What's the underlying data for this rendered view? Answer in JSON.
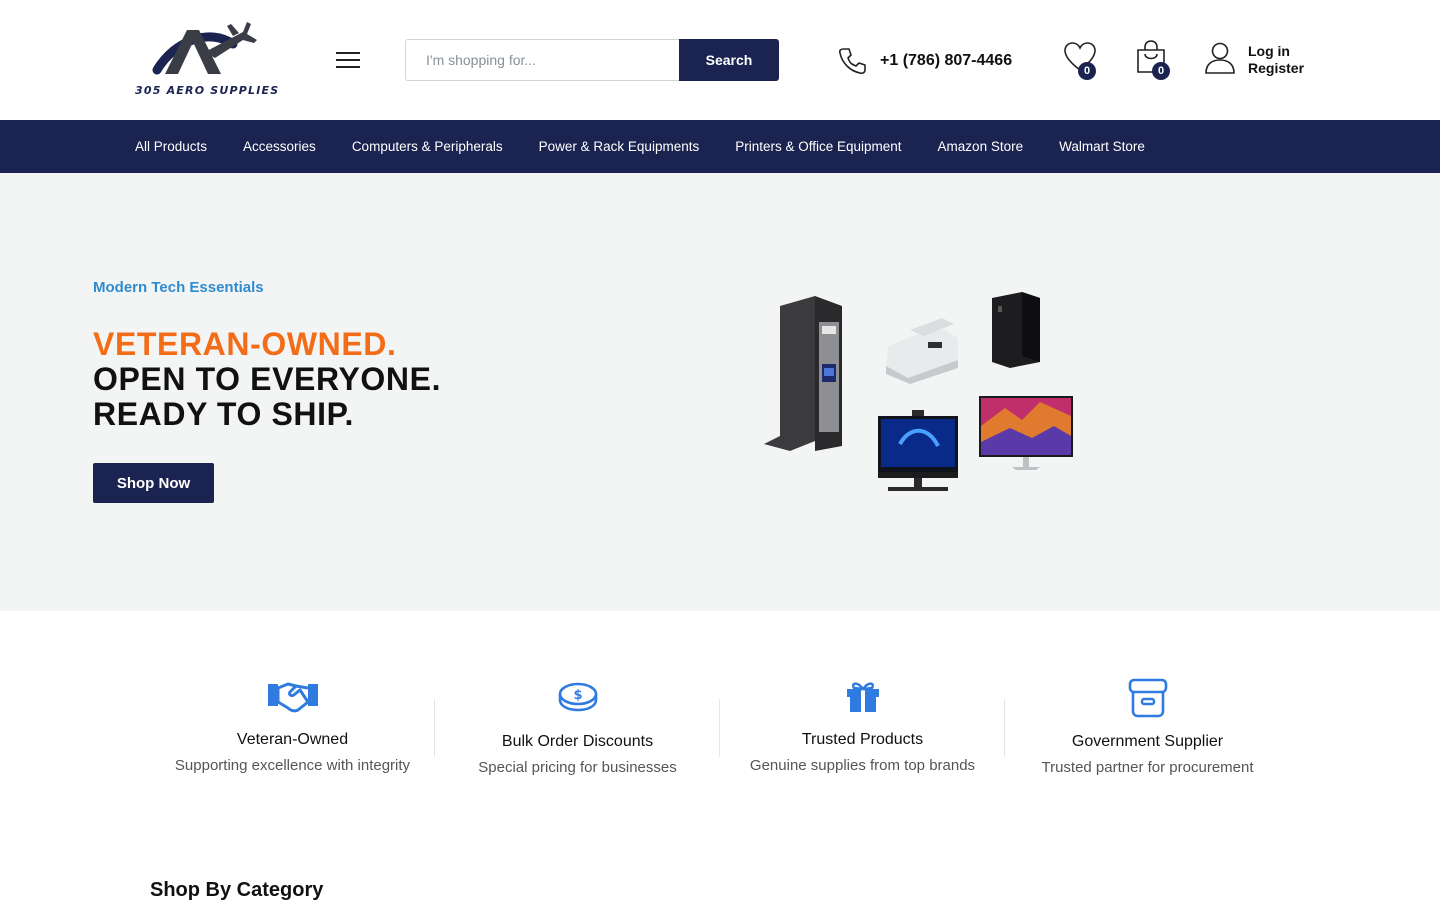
{
  "header": {
    "logo_text": "305  AERO  SUPPLIES",
    "search_placeholder": "I'm shopping for...",
    "search_button": "Search",
    "phone": "+1 (786) 807-4466",
    "wishlist_count": "0",
    "cart_count": "0",
    "login": "Log in",
    "register": "Register"
  },
  "nav": {
    "items": [
      "All Products",
      "Accessories",
      "Computers & Peripherals",
      "Power & Rack Equipments",
      "Printers & Office Equipment",
      "Amazon Store",
      "Walmart Store"
    ]
  },
  "hero": {
    "kicker": "Modern Tech Essentials",
    "headline_accent": "VETERAN-OWNED.",
    "headline_line2": "OPEN TO EVERYONE.",
    "headline_line3": "READY TO SHIP.",
    "cta": "Shop Now"
  },
  "features": [
    {
      "title": "Veteran-Owned",
      "subtitle": "Supporting excellence with integrity",
      "icon": "handshake-icon"
    },
    {
      "title": "Bulk Order Discounts",
      "subtitle": "Special pricing for businesses",
      "icon": "coins-icon"
    },
    {
      "title": "Trusted Products",
      "subtitle": "Genuine supplies from top brands",
      "icon": "gift-icon"
    },
    {
      "title": "Government Supplier",
      "subtitle": "Trusted partner for procurement",
      "icon": "archive-box-icon"
    }
  ],
  "sections": {
    "category_title": "Shop By Category"
  },
  "colors": {
    "brand_navy": "#1b2350",
    "accent_orange": "#f36c17",
    "kicker_blue": "#2f8bcf",
    "feature_icon_blue": "#2f7be0",
    "hero_bg": "#f3f5f5"
  }
}
